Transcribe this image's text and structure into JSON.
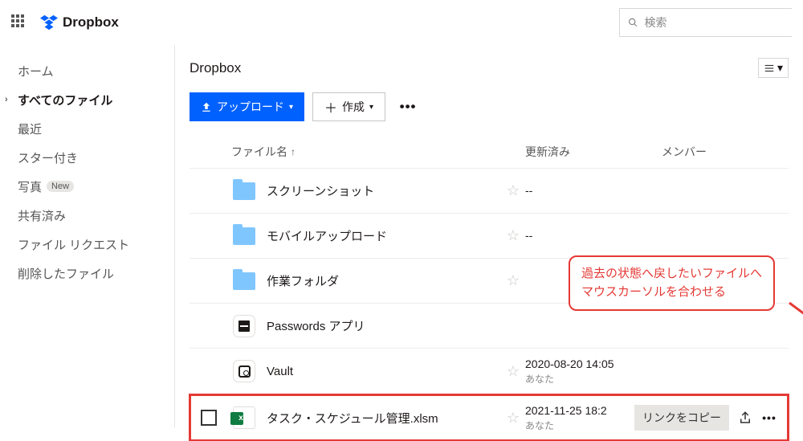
{
  "brand": {
    "name": "Dropbox"
  },
  "search": {
    "placeholder": "検索"
  },
  "sidebar": {
    "items": [
      {
        "label": "ホーム"
      },
      {
        "label": "すべてのファイル"
      },
      {
        "label": "最近"
      },
      {
        "label": "スター付き"
      },
      {
        "label": "写真",
        "badge": "New"
      },
      {
        "label": "共有済み"
      },
      {
        "label": "ファイル リクエスト"
      },
      {
        "label": "削除したファイル"
      }
    ]
  },
  "page": {
    "title": "Dropbox",
    "upload_label": "アップロード",
    "create_label": "作成"
  },
  "columns": {
    "name": "ファイル名",
    "updated": "更新済み",
    "members": "メンバー"
  },
  "rows": [
    {
      "type": "folder",
      "name": "スクリーンショット",
      "updated": "--",
      "updated_sub": "",
      "members": ""
    },
    {
      "type": "folder",
      "name": "モバイルアップロード",
      "updated": "--",
      "updated_sub": "",
      "members": ""
    },
    {
      "type": "folder",
      "name": "作業フォルダ",
      "updated": "",
      "updated_sub": "",
      "members": ""
    },
    {
      "type": "app-pw",
      "name": "Passwords アプリ",
      "updated": "",
      "updated_sub": "",
      "members": ""
    },
    {
      "type": "app-vault",
      "name": "Vault",
      "updated": "2020-08-20 14:05",
      "updated_sub": "あなた",
      "members": ""
    },
    {
      "type": "file-xlsm",
      "name": "タスク・スケジュール管理.xlsm",
      "updated": "2021-11-25 18:2",
      "updated_sub": "あなた",
      "members": ""
    }
  ],
  "hover_actions": {
    "copy_link": "リンクをコピー"
  },
  "annotation": {
    "line1": "過去の状態へ戻したいファイルへ",
    "line2": "マウスカーソルを合わせる"
  }
}
